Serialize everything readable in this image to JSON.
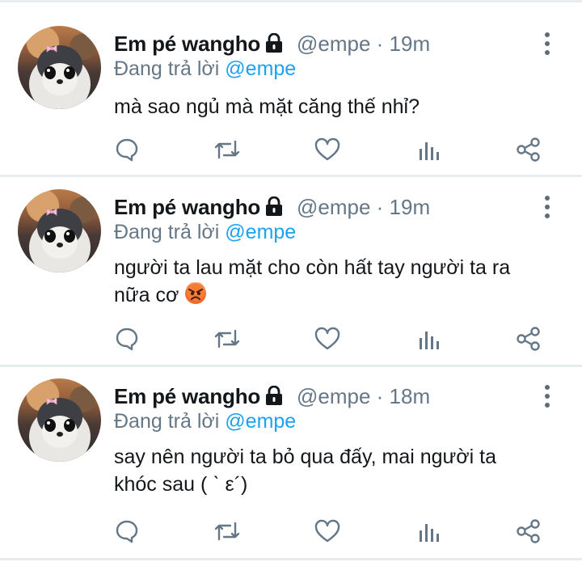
{
  "tweets": [
    {
      "display_name": "Em pé wangho",
      "handle": "@empe",
      "time": "· 19m",
      "reply_prefix": "Đang trả lời",
      "reply_to": "@empe",
      "text": "mà sao ngủ mà mặt căng thế nhỉ?"
    },
    {
      "display_name": "Em pé wangho",
      "handle": "@empe",
      "time": "· 19m",
      "reply_prefix": "Đang trả lời",
      "reply_to": "@empe",
      "text_line1": "người ta lau mặt cho còn hất tay người ta ra",
      "text_line2": "nữa cơ"
    },
    {
      "display_name": "Em pé wangho",
      "handle": "@empe",
      "time": "· 18m",
      "reply_prefix": "Đang trả lời",
      "reply_to": "@empe",
      "text_line1": "say nên người ta bỏ qua đấy, mai người ta",
      "text_line2": "khóc sau ( ˋ ε´)"
    }
  ],
  "icons": {
    "lock": "lock-icon",
    "menu": "more-vertical-icon",
    "reply": "comment-icon",
    "retweet": "retweet-icon",
    "like": "heart-icon",
    "analytics": "analytics-icon",
    "share": "share-icon",
    "emoji": "angry-face-emoji"
  },
  "colors": {
    "accent": "#1da1f2",
    "secondary_text": "#657786",
    "icon": "#657786",
    "divider": "#e6ecf0"
  }
}
